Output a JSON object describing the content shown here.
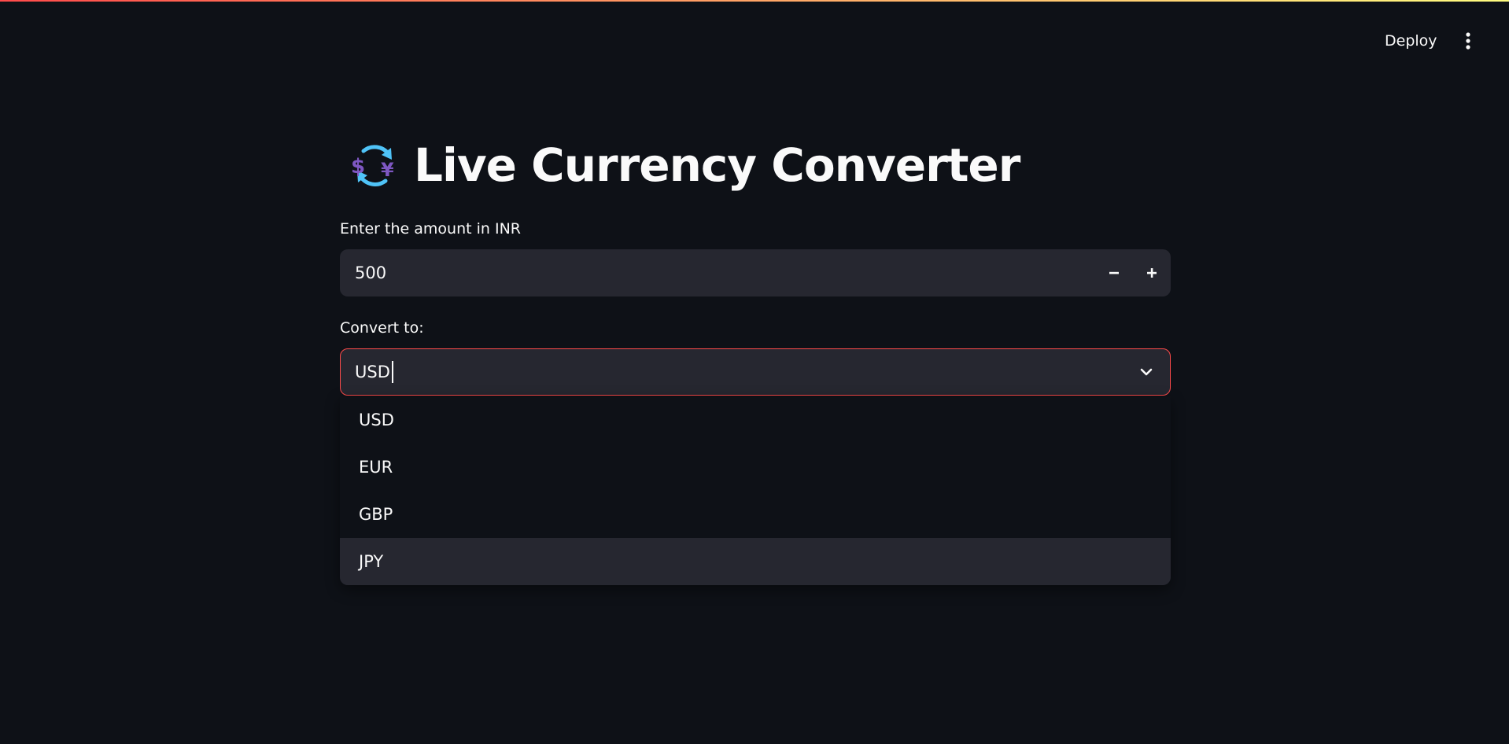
{
  "header": {
    "deploy_label": "Deploy",
    "menu_icon": "kebab-menu-icon"
  },
  "title": {
    "icon": "currency-exchange-icon",
    "text": "Live Currency Converter"
  },
  "amount_input": {
    "label": "Enter the amount in INR",
    "value": "500",
    "decrement_icon": "minus-icon",
    "increment_icon": "plus-icon"
  },
  "currency_select": {
    "label": "Convert to:",
    "value": "USD",
    "chevron_icon": "chevron-down-icon",
    "options": [
      "USD",
      "EUR",
      "GBP",
      "JPY"
    ],
    "highlighted_option": "JPY"
  },
  "colors": {
    "background": "#0e1117",
    "input_background": "#262730",
    "focus_border": "#ff4b4b",
    "text": "#fafafa"
  }
}
